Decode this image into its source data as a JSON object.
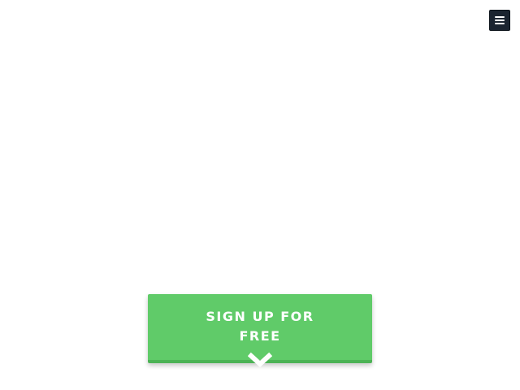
{
  "header": {
    "menu_icon": "hamburger-menu-icon",
    "menu_button_color": "#1b2430"
  },
  "hero": {
    "cta_label": "SIGN UP FOR FREE",
    "cta_color": "#60cb69",
    "cta_border_color": "#4cb355",
    "scroll_icon": "chevron-down-icon"
  }
}
